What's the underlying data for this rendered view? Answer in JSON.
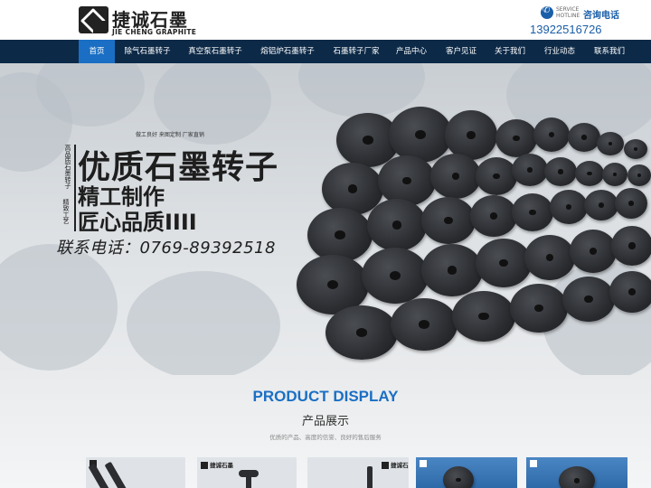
{
  "header": {
    "logo_cn": "捷诚石墨",
    "logo_en": "JIE CHENG GRAPHITE",
    "hotline_en": "SERVICE HOTLINE",
    "hotline_cn": "咨询电话",
    "hotline_number": "13922516726"
  },
  "nav": {
    "items": [
      {
        "label": "首页"
      },
      {
        "label": "除气石墨转子"
      },
      {
        "label": "真空泵石墨转子"
      },
      {
        "label": "熔铝炉石墨转子"
      },
      {
        "label": "石墨转子厂家"
      },
      {
        "label": "产品中心"
      },
      {
        "label": "客户见证"
      },
      {
        "label": "关于我们"
      },
      {
        "label": "行业动态"
      },
      {
        "label": "联系我们"
      }
    ],
    "active_index": 0
  },
  "banner": {
    "tagline": "做工良好  来图定制  厂家直销",
    "title": "优质石墨转子",
    "side_text": "高品质石墨转子",
    "side_text_2": "精致工艺",
    "line1": "精工制作",
    "line2": "匠心品质IIII",
    "phone": "联系电话：0769-89392518"
  },
  "products": {
    "title_en": "PRODUCT DISPLAY",
    "title_cn": "产品展示",
    "subtitle": "优质的产品、高度的信誉、良好的售后服务",
    "card_logo": "捷诚石墨"
  },
  "colors": {
    "nav_bg": "#0c2947",
    "nav_active": "#1a6fc4",
    "accent": "#1a6fc4"
  }
}
